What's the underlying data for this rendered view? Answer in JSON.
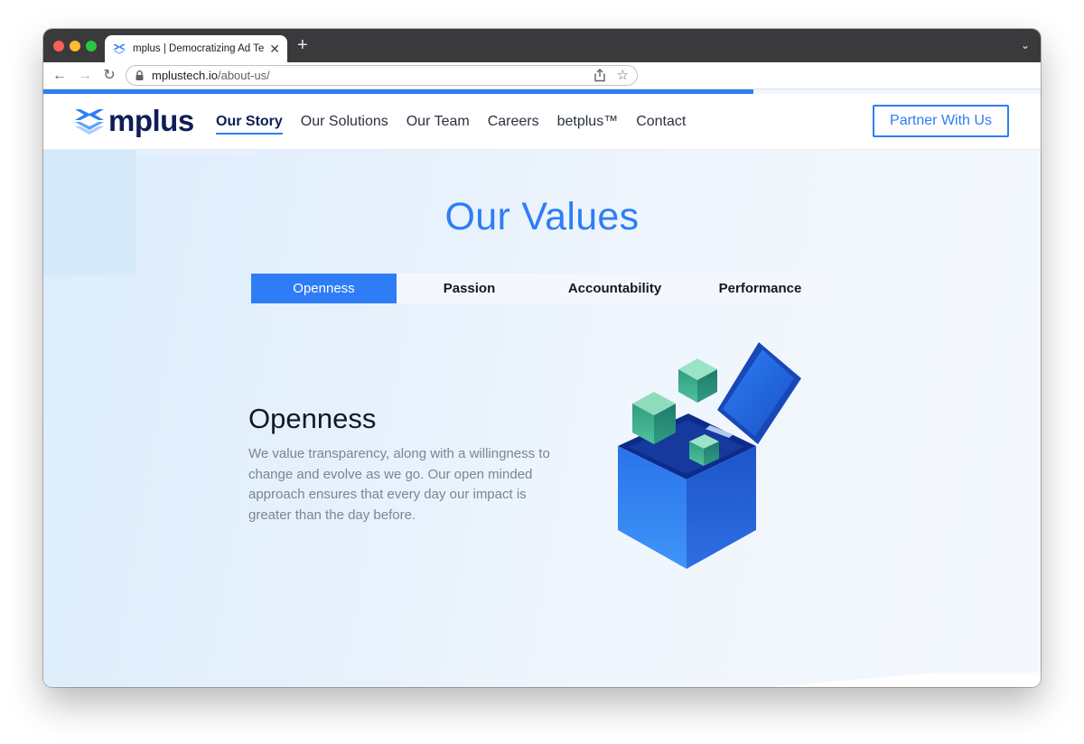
{
  "browser": {
    "tab_title": "mplus | Democratizing Ad Tech",
    "url_host": "mplustech.io",
    "url_path": "/about-us/"
  },
  "site": {
    "logo_text": "mplus",
    "nav": [
      {
        "label": "Our Story",
        "active": true
      },
      {
        "label": "Our Solutions",
        "active": false
      },
      {
        "label": "Our Team",
        "active": false
      },
      {
        "label": "Careers",
        "active": false
      },
      {
        "label": "betplus™",
        "active": false
      },
      {
        "label": "Contact",
        "active": false
      }
    ],
    "cta_label": "Partner With Us"
  },
  "values": {
    "title": "Our Values",
    "tabs": [
      {
        "label": "Openness",
        "active": true
      },
      {
        "label": "Passion",
        "active": false
      },
      {
        "label": "Accountability",
        "active": false
      },
      {
        "label": "Performance",
        "active": false
      }
    ],
    "selected": {
      "heading": "Openness",
      "description": "We value transparency, along with a willingness to change and evolve as we go. Our open minded approach ensures that every day our impact is greater than the day before."
    }
  },
  "colors": {
    "brand_blue": "#2f7df6",
    "brand_navy": "#0f1d57",
    "cube_green": "#3aa58a"
  },
  "icons": {
    "tab_favicon": "mplus-logo-icon",
    "lock": "lock-icon",
    "share": "share-icon",
    "bookmark": "star-icon"
  }
}
